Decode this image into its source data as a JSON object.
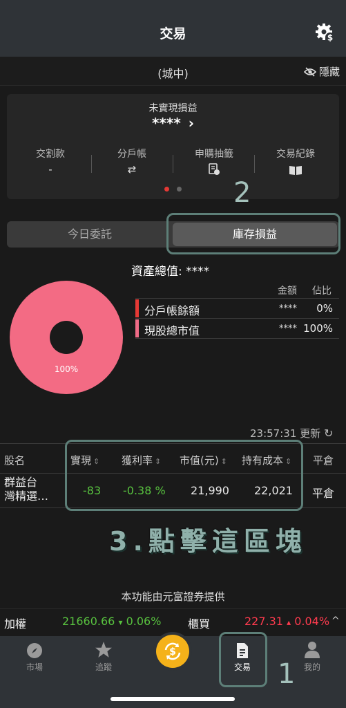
{
  "header": {
    "title": "交易"
  },
  "branch": {
    "name": "(城中)",
    "hide_label": "隱藏"
  },
  "summary": {
    "title": "未實現損益",
    "value": "****",
    "chevron": "›",
    "actions": [
      {
        "label": "交割款",
        "sub": "-"
      },
      {
        "label": "分戶帳",
        "sub": "⇄"
      },
      {
        "label": "申購抽籤",
        "sub": ""
      },
      {
        "label": "交易紀錄",
        "sub": ""
      }
    ]
  },
  "tabs": {
    "left": "今日委託",
    "right": "庫存損益"
  },
  "annotations": {
    "n1": "1",
    "n2": "2",
    "caption": "3.點擊這區塊"
  },
  "assets": {
    "total_label": "資產總值: ****",
    "col_amount": "金額",
    "col_ratio": "佔比",
    "rows": [
      {
        "label": "分戶帳餘額",
        "amount": "****",
        "ratio": "0%"
      },
      {
        "label": "現股總市值",
        "amount": "****",
        "ratio": "100%"
      }
    ],
    "donut_label": "100%",
    "colors": {
      "row1": "#e53935",
      "row2": "#ef6b87",
      "donut": "#f36b84"
    }
  },
  "update": {
    "time": "23:57:31",
    "label": "更新"
  },
  "table": {
    "headers": [
      "股名",
      "實現",
      "獲利率",
      "市值(元)",
      "持有成本",
      "平倉"
    ],
    "sort_glyph": "⇕",
    "rows": [
      {
        "name1": "群益台",
        "name2": "灣精選…",
        "realized": "-83",
        "rate": "-0.38 %",
        "market": "21,990",
        "cost": "22,021",
        "action": "平倉"
      }
    ]
  },
  "provider": "本功能由元富證券提供",
  "ticker": {
    "idx1": {
      "name": "加權",
      "value": "21660.66",
      "arrow": "▾",
      "change": "0.06%"
    },
    "idx2": {
      "name": "櫃買",
      "value": "227.31",
      "arrow": "▴",
      "change": "0.04%"
    },
    "chevron": "^"
  },
  "tabbar": {
    "items": [
      {
        "label": "市場"
      },
      {
        "label": "追蹤"
      },
      {
        "label": ""
      },
      {
        "label": "交易"
      },
      {
        "label": "我的"
      }
    ]
  }
}
